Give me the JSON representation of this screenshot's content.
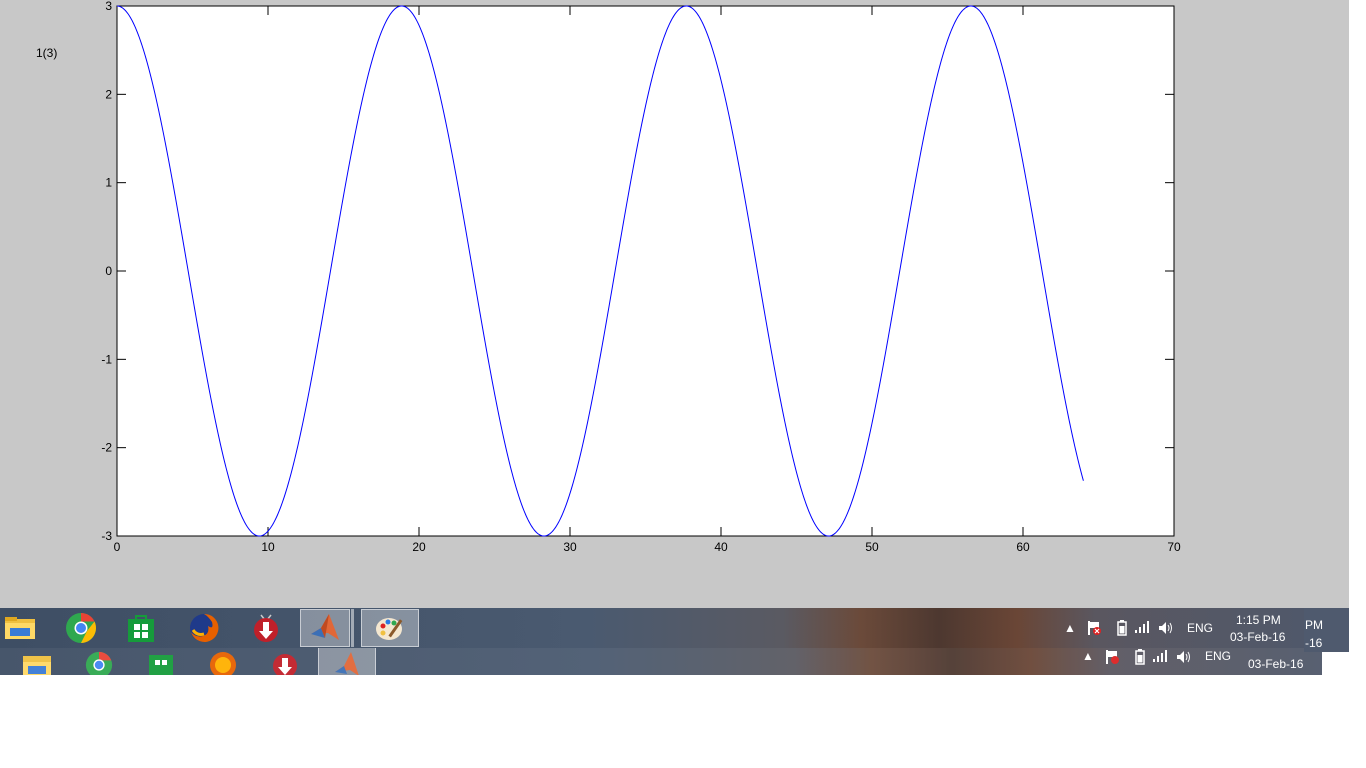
{
  "figure": {
    "label": "1(3)"
  },
  "chart_data": {
    "type": "line",
    "function": "3*cos(t/3)",
    "x_start": 0,
    "x_end": 64,
    "xlim": [
      0,
      70
    ],
    "ylim": [
      -3,
      3
    ],
    "xticks": [
      0,
      10,
      20,
      30,
      40,
      50,
      60,
      70
    ],
    "yticks": [
      3,
      2,
      1,
      0,
      -1,
      -2,
      -3
    ],
    "line_color": "#0000ff",
    "grid": false
  },
  "taskbar": {
    "apps": [
      {
        "icon": "file-explorer-icon",
        "active": false
      },
      {
        "icon": "chrome-icon",
        "active": false
      },
      {
        "icon": "windows-store-icon",
        "active": false
      },
      {
        "icon": "firefox-icon",
        "active": false
      },
      {
        "icon": "downloader-icon",
        "active": false
      },
      {
        "icon": "matlab-icon",
        "active": true
      },
      {
        "icon": "paint-icon",
        "active": true
      }
    ],
    "tray": {
      "language": "ENG",
      "time": "1:15 PM",
      "date": "03-Feb-16",
      "ghost_time_fragment": "PM",
      "ghost_date_fragment": "-16",
      "ghost_language": "ENG",
      "ghost_date": "03-Feb-16"
    }
  }
}
